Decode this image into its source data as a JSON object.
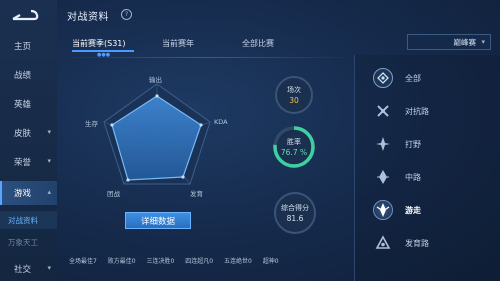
{
  "sidebar": {
    "items": [
      {
        "label": "主页",
        "chevron": false
      },
      {
        "label": "战绩",
        "chevron": false
      },
      {
        "label": "英雄",
        "chevron": false
      },
      {
        "label": "皮肤",
        "chevron": true
      },
      {
        "label": "荣誉",
        "chevron": true
      },
      {
        "label": "游戏",
        "chevron": true
      }
    ],
    "subitems": [
      {
        "label": "对战资料"
      },
      {
        "label": "万象天工"
      }
    ],
    "last_item": {
      "label": "社交"
    }
  },
  "header": {
    "title": "对战资料",
    "help_glyph": "?"
  },
  "tabs": [
    {
      "label": "当前赛季(S31)"
    },
    {
      "label": "当前赛年"
    },
    {
      "label": "全部比赛"
    }
  ],
  "dropdown": {
    "selected": "巅峰赛"
  },
  "radar": {
    "labels": {
      "top": "输出",
      "right": "KDA",
      "bottom_right": "发育",
      "bottom_left": "团战",
      "left": "生存"
    }
  },
  "stats": {
    "matches": {
      "label": "场次",
      "value": "30"
    },
    "winrate": {
      "label": "胜率",
      "value": "76.7 %",
      "fraction": 0.767
    },
    "score": {
      "label": "综合得分",
      "value": "81.6"
    }
  },
  "detail_button": {
    "label": "详细数据"
  },
  "bottom_stats": [
    "全场最佳7",
    "败方最佳0",
    "三连决胜0",
    "四连超凡0",
    "五连绝世0",
    "超神0"
  ],
  "roles": [
    {
      "label": "全部",
      "icon": "all-roles-icon"
    },
    {
      "label": "对抗路",
      "icon": "clash-lane-icon"
    },
    {
      "label": "打野",
      "icon": "jungle-icon"
    },
    {
      "label": "中路",
      "icon": "mid-lane-icon"
    },
    {
      "label": "游走",
      "icon": "roam-icon",
      "active": true
    },
    {
      "label": "发育路",
      "icon": "farm-lane-icon"
    }
  ],
  "colors": {
    "accent": "#4a9bff",
    "winrate_ring": "#3fd0a0"
  }
}
